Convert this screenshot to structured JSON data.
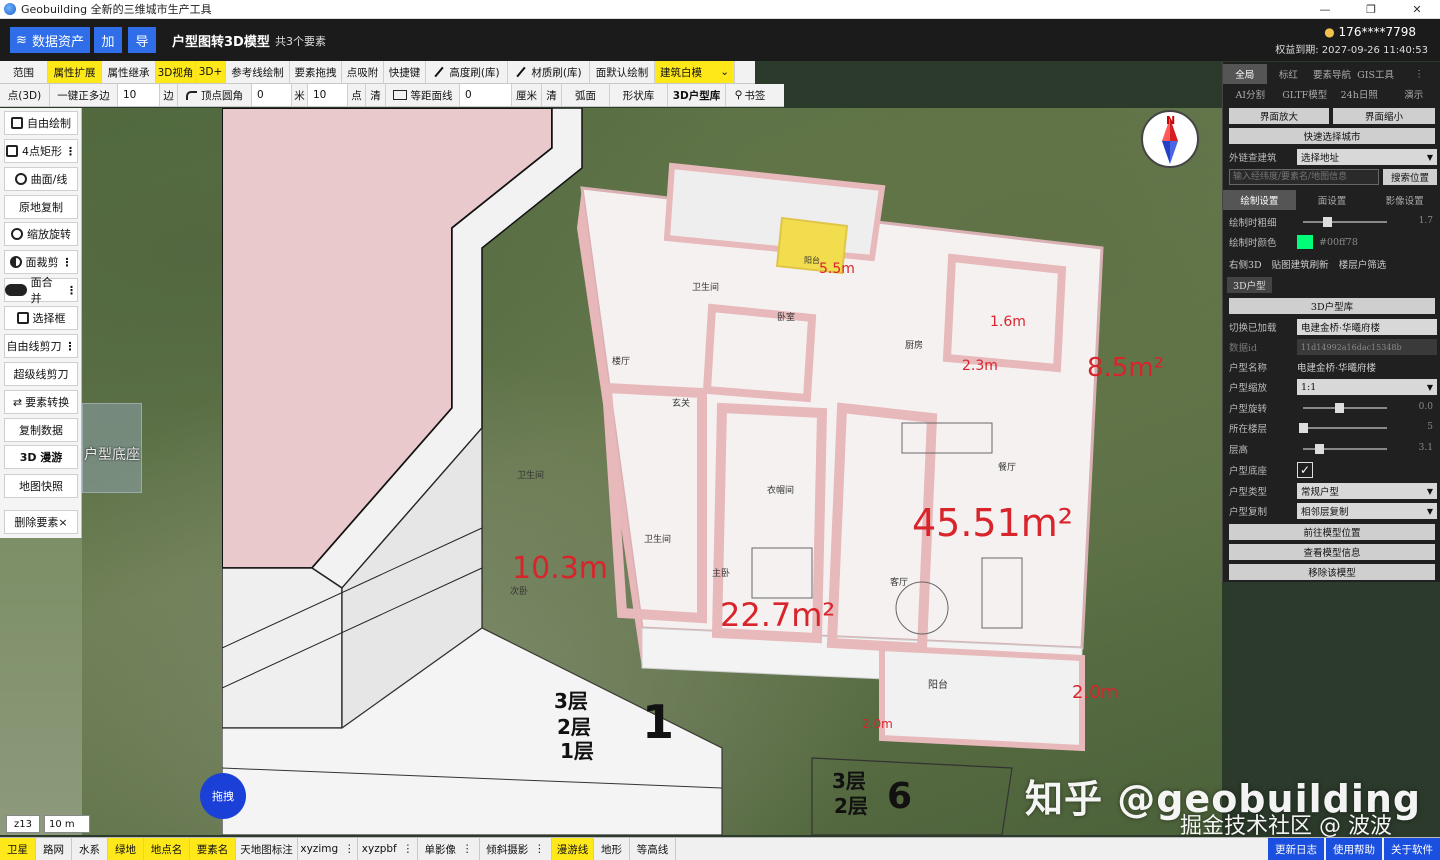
{
  "window": {
    "title": "Geobuilding 全新的三维城市生产工具",
    "minimize": "—",
    "maximize": "❐",
    "close": "✕"
  },
  "header": {
    "data_assets": "数据资产",
    "add": "加",
    "export": "导",
    "title": "户型图转3D模型",
    "subtitle": "共3个要素",
    "user": "176****7798",
    "expire": "权益到期: 2027-09-26 11:40:53"
  },
  "toolbar1": [
    "范围",
    "属性扩展",
    "属性继承",
    "3D视角",
    "3D+",
    "参考线绘制",
    "要素拖拽",
    "点吸附",
    "快捷键",
    "高度刷(库)",
    "材质刷(库)",
    "面默认绘制",
    "建筑白模"
  ],
  "toolbar2": {
    "point3d": "点(3D)",
    "polygon_label": "一键正多边",
    "polygon_value": "10",
    "edge": "边",
    "vertex_round": "顶点圆角",
    "round_value": "0",
    "meter": "米",
    "point_value": "10",
    "point": "点",
    "clear1": "清",
    "equidist": "等距面线",
    "equidist_value": "0",
    "cm": "厘米",
    "clear2": "清",
    "arc": "弧面",
    "shape_lib": "形状库",
    "house_lib": "3D户型库",
    "bookmark": "书签"
  },
  "left_tools": [
    "自由绘制",
    "4点矩形",
    "曲面/线",
    "原地复制",
    "缩放旋转",
    "面裁剪",
    "面合并",
    "选择框",
    "自由线剪刀",
    "超级线剪刀",
    "要素转换",
    "复制数据",
    "3D 漫游",
    "地图快照",
    "删除要素×"
  ],
  "map": {
    "podium_label": "户型底座",
    "zoom": "z13",
    "scale": "10 m",
    "drag": "拖拽",
    "compass_n": "N",
    "watermark": "知乎 @geobuilding",
    "watermark2": "掘金技术社区 @ 波波"
  },
  "plan": {
    "areas": [
      "5.5m",
      "1.6m",
      "2.3m",
      "8.5m²",
      "2.0m",
      "45.51m²",
      "10.3m",
      "22.7m²",
      "2.0m"
    ],
    "rooms": [
      "卫生间",
      "卧室",
      "厨房",
      "楼厅",
      "玄关",
      "卫生间",
      "衣帽间",
      "餐厅",
      "卫生间",
      "主卧",
      "次卧",
      "客厅",
      "阳台",
      "阳台"
    ],
    "floors_a": [
      "3层",
      "2层",
      "1层"
    ],
    "floors_b": [
      "3层",
      "2层"
    ],
    "building_numbers": [
      "1",
      "6"
    ]
  },
  "right_panel": {
    "tabs1": [
      "全局",
      "标红",
      "要素导航",
      "GIS工具",
      "⋮"
    ],
    "tabs2": [
      "AI分割",
      "GLTF模型",
      "24h日照",
      "演示"
    ],
    "zoom_in": "界面放大",
    "zoom_out": "界面缩小",
    "quick_city": "快速选择城市",
    "ext_building_label": "外链查建筑",
    "ext_building_value": "选择地址",
    "search_placeholder": "输入经纬度/要素名/地图信息",
    "search_btn": "搜索位置",
    "tabs3": [
      "绘制设置",
      "面设置",
      "影像设置"
    ],
    "line_width_label": "绘制时粗细",
    "line_width_value": "1.7",
    "color_label": "绘制时颜色",
    "color_value": "#00ff78",
    "links": [
      "右侧3D",
      "贴图建筑刷新",
      "楼层户筛选"
    ],
    "section_3d": "3D户型",
    "lib_btn": "3D户型库",
    "switch_label": "切换已加载",
    "switch_value": "电建金桥·华曦府楼",
    "data_id_label": "数据id",
    "data_id_value": "11d14992a16dac15348b",
    "name_label": "户型名称",
    "name_value": "电建金桥·华曦府楼",
    "scale_label": "户型缩放",
    "scale_value": "1:1",
    "rotate_label": "户型旋转",
    "rotate_value": "0.0",
    "floor_label": "所在楼层",
    "floor_value": "5",
    "height_label": "层高",
    "height_value": "3.1",
    "base_label": "户型底座",
    "base_checked": "✓",
    "type_label": "户型类型",
    "type_value": "常规户型",
    "copy_label": "户型复制",
    "copy_value": "相邻层复制",
    "goto_btn": "前往模型位置",
    "info_btn": "查看模型信息",
    "remove_btn": "移除该模型"
  },
  "bottom": [
    "卫星",
    "路网",
    "水系",
    "绿地",
    "地点名",
    "要素名",
    "天地图标注",
    "xyzimg",
    "xyzpbf",
    "单影像",
    "倾斜摄影",
    "漫游线",
    "地形",
    "等高线"
  ],
  "bottom_right": [
    "更新日志",
    "使用帮助",
    "关于软件"
  ]
}
